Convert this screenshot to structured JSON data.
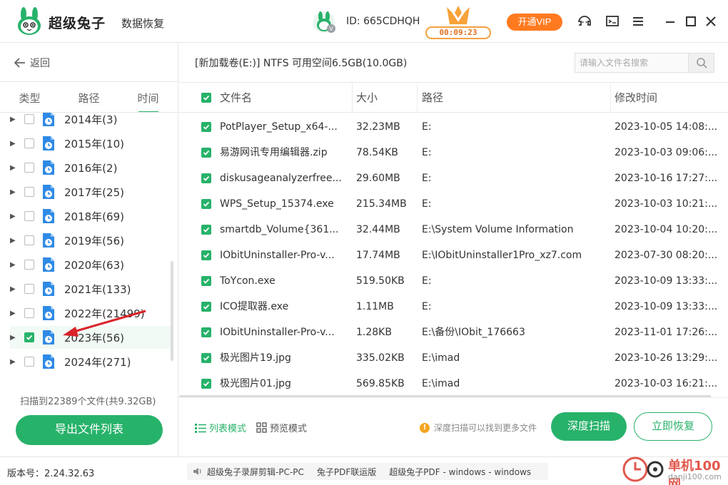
{
  "app": {
    "name": "超级兔子",
    "subtitle": "数据恢复",
    "user_id": "ID: 665CDHQH",
    "vip_timer": "00:09:23",
    "vip_button": "开通VIP"
  },
  "sidebar": {
    "back_label": "返回",
    "tabs": [
      {
        "label": "类型",
        "active": false
      },
      {
        "label": "路径",
        "active": false
      },
      {
        "label": "时间",
        "active": true
      }
    ],
    "years": [
      {
        "label": "2014年(3)",
        "checked": false
      },
      {
        "label": "2015年(10)",
        "checked": false
      },
      {
        "label": "2016年(2)",
        "checked": false
      },
      {
        "label": "2017年(25)",
        "checked": false
      },
      {
        "label": "2018年(69)",
        "checked": false
      },
      {
        "label": "2019年(56)",
        "checked": false
      },
      {
        "label": "2020年(63)",
        "checked": false
      },
      {
        "label": "2021年(133)",
        "checked": false
      },
      {
        "label": "2022年(21499)",
        "checked": false
      },
      {
        "label": "2023年(56)",
        "checked": true
      },
      {
        "label": "2024年(271)",
        "checked": false
      }
    ],
    "scan_summary": "扫描到22389个文件(共9.32GB)",
    "export_button": "导出文件列表"
  },
  "main": {
    "volume_info": "[新加载卷(E:)] NTFS 可用空间6.5GB(10.0GB)",
    "search_placeholder": "请输入文件名搜索",
    "columns": {
      "name": "文件名",
      "size": "大小",
      "path": "路径",
      "mtime": "修改时间"
    },
    "rows": [
      {
        "name": "PotPlayer_Setup_x64-...",
        "size": "32.23MB",
        "path": "E:",
        "mtime": "2023-10-05 14:08:..."
      },
      {
        "name": "易游网讯专用编辑器.zip",
        "size": "78.54KB",
        "path": "E:",
        "mtime": "2023-10-03 09:06:..."
      },
      {
        "name": "diskusageanalyzerfree...",
        "size": "29.60MB",
        "path": "E:",
        "mtime": "2023-10-16 17:27:..."
      },
      {
        "name": "WPS_Setup_15374.exe",
        "size": "215.34MB",
        "path": "E:",
        "mtime": "2023-10-03 10:21:..."
      },
      {
        "name": "smartdb_Volume{361...",
        "size": "32.44MB",
        "path": "E:\\System Volume Information",
        "mtime": "2023-10-04 10:20:..."
      },
      {
        "name": "IObitUninstaller-Pro-v...",
        "size": "17.74MB",
        "path": "E:\\IObitUninstaller1Pro_xz7.com",
        "mtime": "2023-07-30 08:20:..."
      },
      {
        "name": "ToYcon.exe",
        "size": "519.50KB",
        "path": "E:",
        "mtime": "2023-10-09 13:33:..."
      },
      {
        "name": "ICO提取器.exe",
        "size": "1.11MB",
        "path": "E:",
        "mtime": "2023-10-09 13:33:..."
      },
      {
        "name": "IObitUninstaller-Pro-v...",
        "size": "1.28KB",
        "path": "E:\\备份\\IObit_176663",
        "mtime": "2023-11-01 17:26:..."
      },
      {
        "name": "极光图片19.jpg",
        "size": "335.02KB",
        "path": "E:\\imad",
        "mtime": "2023-10-26 13:29:..."
      },
      {
        "name": "极光图片01.jpg",
        "size": "569.85KB",
        "path": "E:\\imad",
        "mtime": "2023-10-03 16:21:..."
      }
    ],
    "view_list_label": "列表模式",
    "view_preview_label": "预览模式",
    "tip": "深度扫描可以找到更多文件",
    "deep_scan_button": "深度扫描",
    "recover_button": "立即恢复"
  },
  "status": {
    "version": "版本号：2.24.32.63",
    "news": [
      "超级兔子录屏剪辑-PC-PC",
      "兔子PDF联运版",
      "超级兔子PDF - windows - windows"
    ]
  },
  "watermark": {
    "line1": "单机100网",
    "line2": "danji100.com"
  },
  "colors": {
    "accent": "#27b26a",
    "vip": "#ff7a1f",
    "annotation": "#d9232a"
  }
}
